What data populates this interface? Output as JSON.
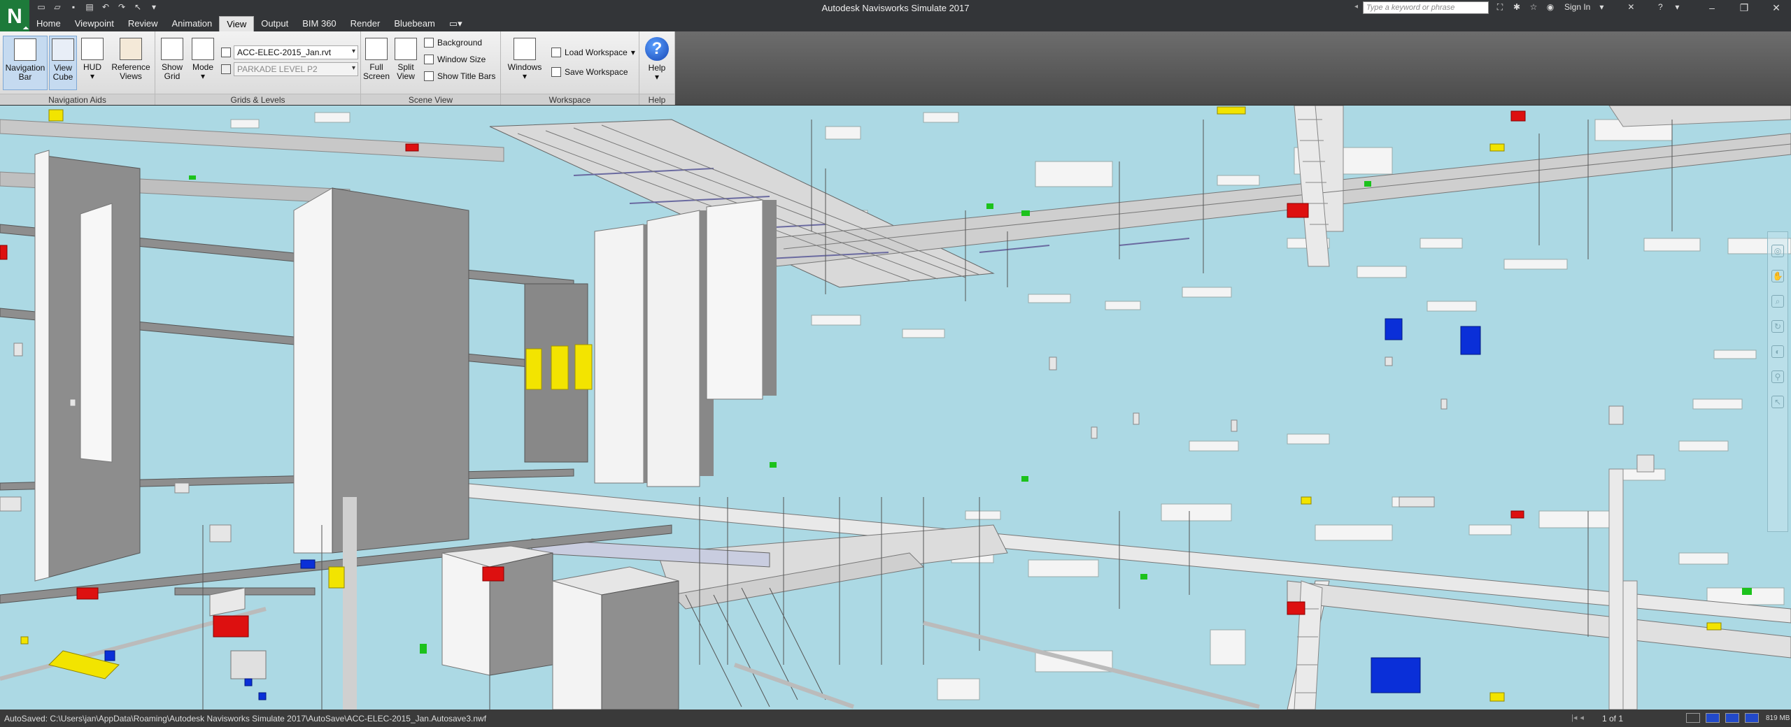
{
  "app": {
    "logo_letter": "N",
    "window_title": "Autodesk Navisworks Simulate 2017"
  },
  "title_bar": {
    "search_placeholder": "Type a keyword or phrase",
    "sign_in_label": "Sign In",
    "window_controls": [
      "–",
      "❐",
      "✕"
    ]
  },
  "menu": {
    "tabs": [
      {
        "label": "Home",
        "active": false
      },
      {
        "label": "Viewpoint",
        "active": false
      },
      {
        "label": "Review",
        "active": false
      },
      {
        "label": "Animation",
        "active": false
      },
      {
        "label": "View",
        "active": true
      },
      {
        "label": "Output",
        "active": false
      },
      {
        "label": "BIM 360",
        "active": false
      },
      {
        "label": "Render",
        "active": false
      },
      {
        "label": "Bluebeam",
        "active": false
      }
    ]
  },
  "ribbon": {
    "navigation_aids": {
      "panel_label": "Navigation Aids",
      "navigation_bar": "Navigation Bar",
      "view_cube": "View Cube",
      "hud": "HUD",
      "reference_views": "Reference Views"
    },
    "grids_levels": {
      "panel_label": "Grids & Levels",
      "show_grid": "Show Grid",
      "mode": "Mode",
      "model_combo": "ACC-ELEC-2015_Jan.rvt",
      "level_combo": "PARKADE LEVEL P2"
    },
    "scene_view": {
      "panel_label": "Scene View",
      "full_screen": "Full Screen",
      "split_view": "Split View",
      "background": "Background",
      "window_size": "Window Size",
      "show_title_bars": "Show Title Bars"
    },
    "workspace": {
      "panel_label": "Workspace",
      "windows": "Windows",
      "load_workspace": "Load Workspace",
      "save_workspace": "Save Workspace"
    },
    "help": {
      "panel_label": "Help",
      "help": "Help"
    }
  },
  "colors": {
    "viewport_background": "#acd9e4",
    "title_bar": "#333538",
    "active_button": "#c5daf0"
  },
  "status_bar": {
    "autosave_text": "AutoSaved: C:\\Users\\jan\\AppData\\Roaming\\Autodesk Navisworks Simulate 2017\\AutoSave\\ACC-ELEC-2015_Jan.Autosave3.nwf",
    "page_count": "1 of 1",
    "memory": "819 MB"
  }
}
